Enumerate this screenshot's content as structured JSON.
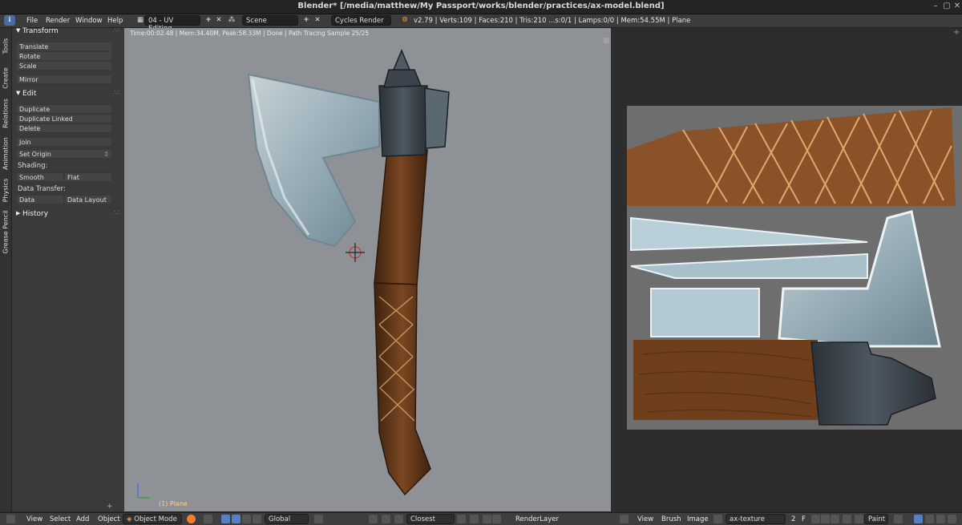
{
  "window": {
    "title": "Blender* [/media/matthew/My Passport/works/blender/practices/ax-model.blend]"
  },
  "info_header": {
    "menus": [
      "File",
      "Render",
      "Window",
      "Help"
    ],
    "screen_layout": "04 - UV Editing",
    "scene": "Scene",
    "render_engine": "Cycles Render",
    "stats": "v2.79 | Verts:109 | Faces:210 | Tris:210 ...s:0/1 | Lamps:0/0 | Mem:54.55M | Plane"
  },
  "left_tabs": [
    "Tools",
    "Create",
    "Relations",
    "Animation",
    "Physics",
    "Grease Pencil"
  ],
  "tool_shelf": {
    "transform_header": "Transform",
    "translate": "Translate",
    "rotate": "Rotate",
    "scale": "Scale",
    "mirror": "Mirror",
    "edit_header": "Edit",
    "duplicate": "Duplicate",
    "duplicate_linked": "Duplicate Linked",
    "delete": "Delete",
    "join": "Join",
    "set_origin": "Set Origin",
    "shading_label": "Shading:",
    "smooth": "Smooth",
    "flat": "Flat",
    "data_transfer_label": "Data Transfer:",
    "data": "Data",
    "data_layout": "Data Layout",
    "history_header": "History"
  },
  "viewport": {
    "render_info": "Time:00:02.48 | Mem:34.40M, Peak:58.33M | Done | Path Tracing Sample 25/25",
    "object_label": "(1) Plane"
  },
  "view3d_header": {
    "menus": [
      "View",
      "Select",
      "Add",
      "Object"
    ],
    "mode": "Object Mode",
    "orientation": "Global",
    "snap_target": "Closest",
    "render_layer": "RenderLayer"
  },
  "image_editor_header": {
    "menus": [
      "View",
      "Brush",
      "Image"
    ],
    "image_name": "ax-texture",
    "users": "2",
    "fake_user": "F",
    "mode": "Paint"
  },
  "colors": {
    "accent": "#5680c2",
    "viewport_bg": "#8e9297",
    "panel_bg": "#3a3a3a",
    "wood": "#6b3f1f",
    "steel": "#9fb2bb"
  }
}
